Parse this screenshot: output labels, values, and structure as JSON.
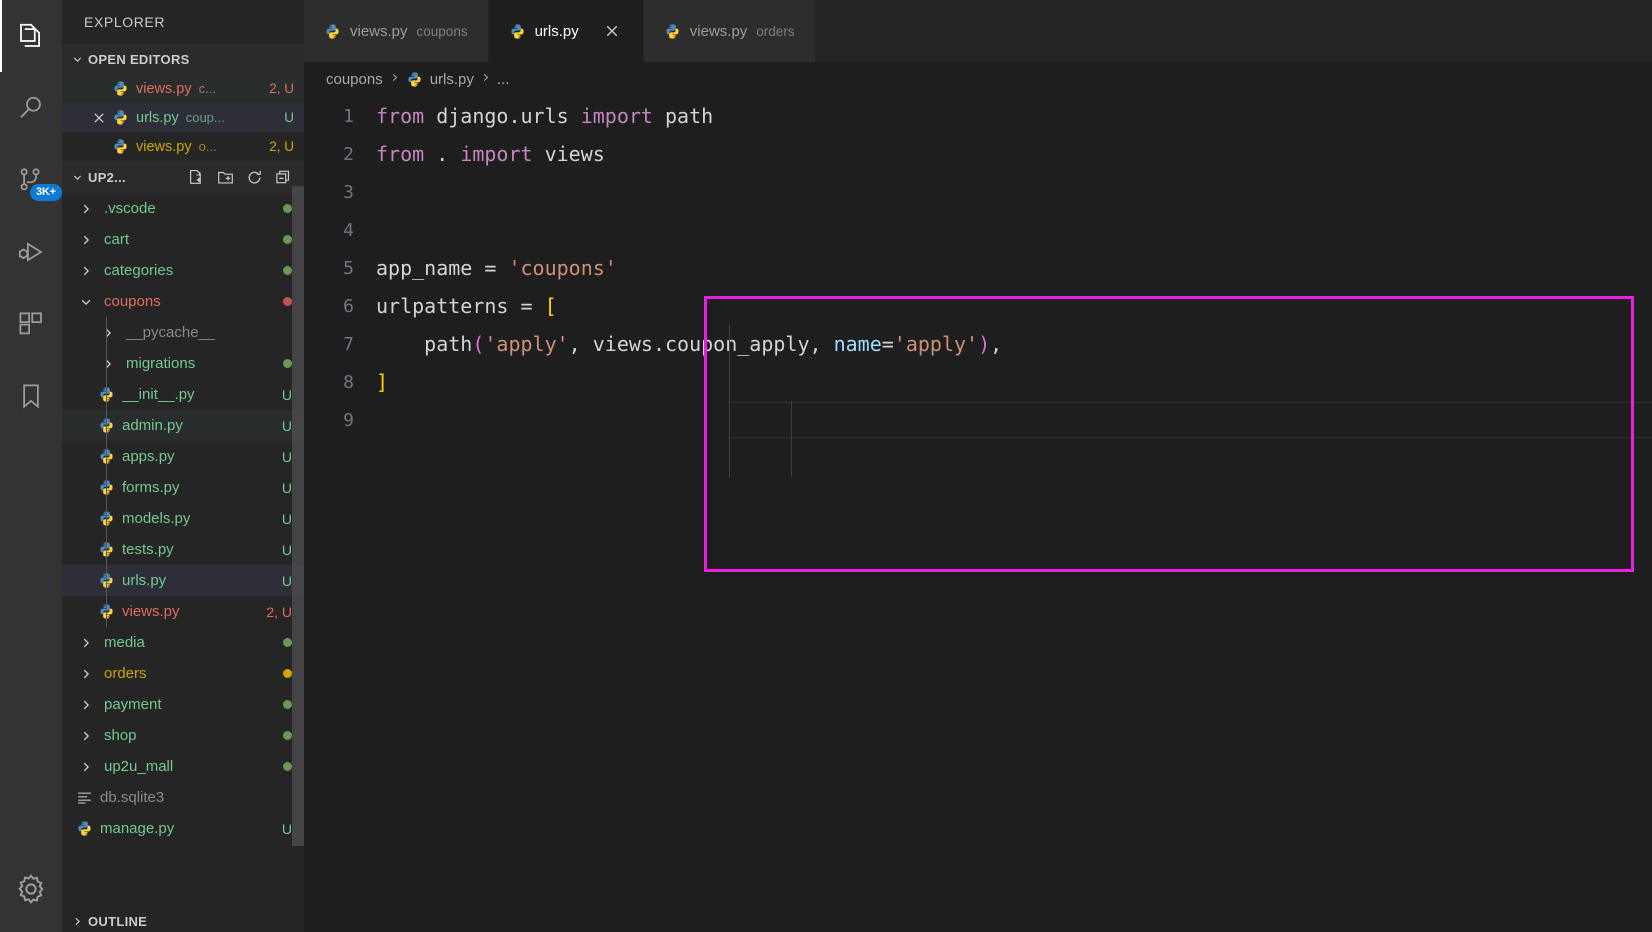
{
  "activity_bar": {
    "items": [
      {
        "name": "explorer",
        "icon": "files-icon",
        "active": true,
        "badge": null
      },
      {
        "name": "search",
        "icon": "search-icon",
        "active": false,
        "badge": null
      },
      {
        "name": "source-control",
        "icon": "source-control-icon",
        "active": false,
        "badge": "3K+"
      },
      {
        "name": "run-and-debug",
        "icon": "run-debug-icon",
        "active": false,
        "badge": null
      },
      {
        "name": "extensions",
        "icon": "extensions-icon",
        "active": false,
        "badge": null
      },
      {
        "name": "bookmarks",
        "icon": "bookmark-icon",
        "active": false,
        "badge": null
      }
    ],
    "bottom": [
      {
        "name": "manage-settings",
        "icon": "gear-icon"
      }
    ],
    "badge_color": "#0e7ad4"
  },
  "sidebar": {
    "title": "EXPLORER",
    "open_editors": {
      "label": "OPEN EDITORS",
      "expanded": true,
      "rows": [
        {
          "icon": "python-file-icon",
          "name": "views.py",
          "desc": "c...",
          "badge": "2, U",
          "color": "#e06c5d",
          "state": "hover"
        },
        {
          "icon": "python-file-icon",
          "name": "urls.py",
          "desc": "coup...",
          "badge": "U",
          "color": "#73c991",
          "state": "selected",
          "close": "close-icon"
        },
        {
          "icon": "python-file-icon",
          "name": "views.py",
          "desc": "o...",
          "badge": "2, U",
          "color": "#cca700",
          "state": "normal"
        }
      ]
    },
    "workspace": {
      "label": "UP2...",
      "expanded": true,
      "actions": [
        "new-file-icon",
        "new-folder-icon",
        "refresh-icon",
        "collapse-all-icon"
      ],
      "rows": [
        {
          "kind": "folder",
          "arrow": "chevron-right",
          "name": ".vscode",
          "depth": 1,
          "color": "#73c991",
          "dot": "#6a9955",
          "status": ""
        },
        {
          "kind": "folder",
          "arrow": "chevron-right",
          "name": "cart",
          "depth": 1,
          "color": "#73c991",
          "dot": "#6a9955",
          "status": ""
        },
        {
          "kind": "folder",
          "arrow": "chevron-right",
          "name": "categories",
          "depth": 1,
          "color": "#73c991",
          "dot": "#6a9955",
          "status": ""
        },
        {
          "kind": "folder",
          "arrow": "chevron-down",
          "name": "coupons",
          "depth": 1,
          "color": "#e06c5d",
          "dot": "#c25450",
          "status": ""
        },
        {
          "kind": "folder",
          "arrow": "chevron-right",
          "name": "__pycache__",
          "depth": 2,
          "color": "#8a8a8a",
          "dot": "",
          "status": ""
        },
        {
          "kind": "folder",
          "arrow": "chevron-right",
          "name": "migrations",
          "depth": 2,
          "color": "#73c991",
          "dot": "#6a9955",
          "status": ""
        },
        {
          "kind": "file",
          "icon": "python-file-icon",
          "name": "__init__.py",
          "depth": 2,
          "color": "#73c991",
          "status": "U"
        },
        {
          "kind": "file",
          "icon": "python-file-icon",
          "name": "admin.py",
          "depth": 2,
          "color": "#73c991",
          "status": "U",
          "state": "hover"
        },
        {
          "kind": "file",
          "icon": "python-file-icon",
          "name": "apps.py",
          "depth": 2,
          "color": "#73c991",
          "status": "U"
        },
        {
          "kind": "file",
          "icon": "python-file-icon",
          "name": "forms.py",
          "depth": 2,
          "color": "#73c991",
          "status": "U"
        },
        {
          "kind": "file",
          "icon": "python-file-icon",
          "name": "models.py",
          "depth": 2,
          "color": "#73c991",
          "status": "U"
        },
        {
          "kind": "file",
          "icon": "python-file-icon",
          "name": "tests.py",
          "depth": 2,
          "color": "#73c991",
          "status": "U"
        },
        {
          "kind": "file",
          "icon": "python-file-icon",
          "name": "urls.py",
          "depth": 2,
          "color": "#73c991",
          "status": "U",
          "state": "selected"
        },
        {
          "kind": "file",
          "icon": "python-file-icon",
          "name": "views.py",
          "depth": 2,
          "color": "#e06c5d",
          "status": "2, U"
        },
        {
          "kind": "folder",
          "arrow": "chevron-right",
          "name": "media",
          "depth": 1,
          "color": "#73c991",
          "dot": "#6a9955",
          "status": ""
        },
        {
          "kind": "folder",
          "arrow": "chevron-right",
          "name": "orders",
          "depth": 1,
          "color": "#cca700",
          "dot": "#cca700",
          "status": ""
        },
        {
          "kind": "folder",
          "arrow": "chevron-right",
          "name": "payment",
          "depth": 1,
          "color": "#73c991",
          "dot": "#6a9955",
          "status": ""
        },
        {
          "kind": "folder",
          "arrow": "chevron-right",
          "name": "shop",
          "depth": 1,
          "color": "#73c991",
          "dot": "#6a9955",
          "status": ""
        },
        {
          "kind": "folder",
          "arrow": "chevron-right",
          "name": "up2u_mall",
          "depth": 1,
          "color": "#73c991",
          "dot": "#6a9955",
          "status": ""
        },
        {
          "kind": "file",
          "icon": "database-icon",
          "name": "db.sqlite3",
          "depth": 1,
          "color": "#8a8a8a",
          "status": ""
        },
        {
          "kind": "file",
          "icon": "python-file-icon",
          "name": "manage.py",
          "depth": 1,
          "color": "#73c991",
          "status": "U"
        }
      ]
    },
    "outline": {
      "label": "OUTLINE",
      "expanded": false
    }
  },
  "editor": {
    "tabs": [
      {
        "icon": "python-file-icon",
        "label": "views.py",
        "desc": "coupons",
        "active": false,
        "closable": false
      },
      {
        "icon": "python-file-icon",
        "label": "urls.py",
        "desc": "",
        "active": true,
        "closable": true,
        "close_icon": "close-icon"
      },
      {
        "icon": "python-file-icon",
        "label": "views.py",
        "desc": "orders",
        "active": false,
        "closable": false
      }
    ],
    "breadcrumb": [
      {
        "label": "coupons",
        "icon": null
      },
      {
        "label": "urls.py",
        "icon": "python-file-icon"
      },
      {
        "label": "...",
        "icon": null
      }
    ],
    "breadcrumb_separator": "›",
    "lines": [
      {
        "n": "1",
        "tokens": [
          {
            "t": "from",
            "c": "kw"
          },
          {
            "t": " django.urls ",
            "c": "id"
          },
          {
            "t": "import",
            "c": "kw"
          },
          {
            "t": " path",
            "c": "id"
          }
        ]
      },
      {
        "n": "2",
        "tokens": [
          {
            "t": "from",
            "c": "kw"
          },
          {
            "t": " . ",
            "c": "id"
          },
          {
            "t": "import",
            "c": "kw"
          },
          {
            "t": " views",
            "c": "id"
          }
        ]
      },
      {
        "n": "3",
        "tokens": []
      },
      {
        "n": "4",
        "tokens": []
      },
      {
        "n": "5",
        "tokens": [
          {
            "t": "app_name ",
            "c": "id"
          },
          {
            "t": "= ",
            "c": "op"
          },
          {
            "t": "'coupons'",
            "c": "str"
          }
        ]
      },
      {
        "n": "6",
        "tokens": [
          {
            "t": "urlpatterns ",
            "c": "id"
          },
          {
            "t": "= ",
            "c": "op"
          },
          {
            "t": "[",
            "c": "br"
          }
        ]
      },
      {
        "n": "7",
        "tokens": [
          {
            "t": "    path",
            "c": "id"
          },
          {
            "t": "(",
            "c": "brp"
          },
          {
            "t": "'apply'",
            "c": "str"
          },
          {
            "t": ", views.coupon_apply, ",
            "c": "id"
          },
          {
            "t": "name",
            "c": "var"
          },
          {
            "t": "=",
            "c": "op"
          },
          {
            "t": "'apply'",
            "c": "str"
          },
          {
            "t": ")",
            "c": "brp"
          },
          {
            "t": ",",
            "c": "id"
          }
        ]
      },
      {
        "n": "8",
        "tokens": [
          {
            "t": "]",
            "c": "br"
          }
        ]
      },
      {
        "n": "9",
        "tokens": [],
        "current": true
      }
    ],
    "highlight": {
      "color": "#e91ee9",
      "label": "annotation-box"
    }
  }
}
